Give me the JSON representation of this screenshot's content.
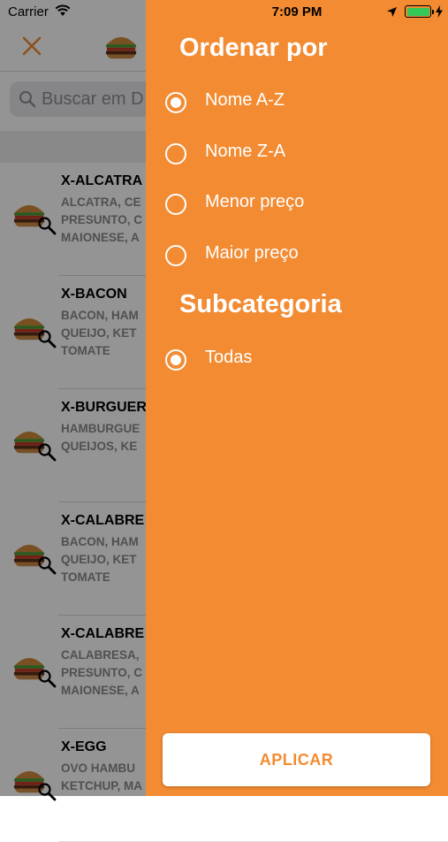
{
  "status": {
    "carrier": "Carrier",
    "time": "7:09 PM"
  },
  "search": {
    "placeholder": "Buscar em D"
  },
  "products": [
    {
      "name": "X-ALCATRA",
      "desc": [
        "ALCATRA, CE",
        "PRESUNTO, C",
        "MAIONESE, A"
      ]
    },
    {
      "name": "X-BACON",
      "desc": [
        "BACON, HAM",
        "QUEIJO, KET",
        "TOMATE"
      ]
    },
    {
      "name": "X-BURGUER",
      "desc": [
        "HAMBURGUE",
        "QUEIJOS, KE"
      ]
    },
    {
      "name": "X-CALABRE",
      "desc": [
        "BACON, HAM",
        "QUEIJO, KET",
        "TOMATE"
      ]
    },
    {
      "name": "X-CALABRE",
      "desc": [
        "CALABRESA,",
        "PRESUNTO, C",
        "MAIONESE, A"
      ]
    },
    {
      "name": "X-EGG",
      "desc": [
        "OVO HAMBU",
        "KETCHUP, MA"
      ]
    }
  ],
  "filter": {
    "sort_title": "Ordenar por",
    "sort_options": [
      {
        "label": "Nome A-Z",
        "selected": true
      },
      {
        "label": "Nome Z-A",
        "selected": false
      },
      {
        "label": "Menor preço",
        "selected": false
      },
      {
        "label": "Maior preço",
        "selected": false
      }
    ],
    "subcategory_title": "Subcategoria",
    "subcategory_options": [
      {
        "label": "Todas",
        "selected": true
      }
    ],
    "apply_label": "APLICAR"
  },
  "colors": {
    "accent": "#f28b32",
    "battery": "#36c759"
  }
}
